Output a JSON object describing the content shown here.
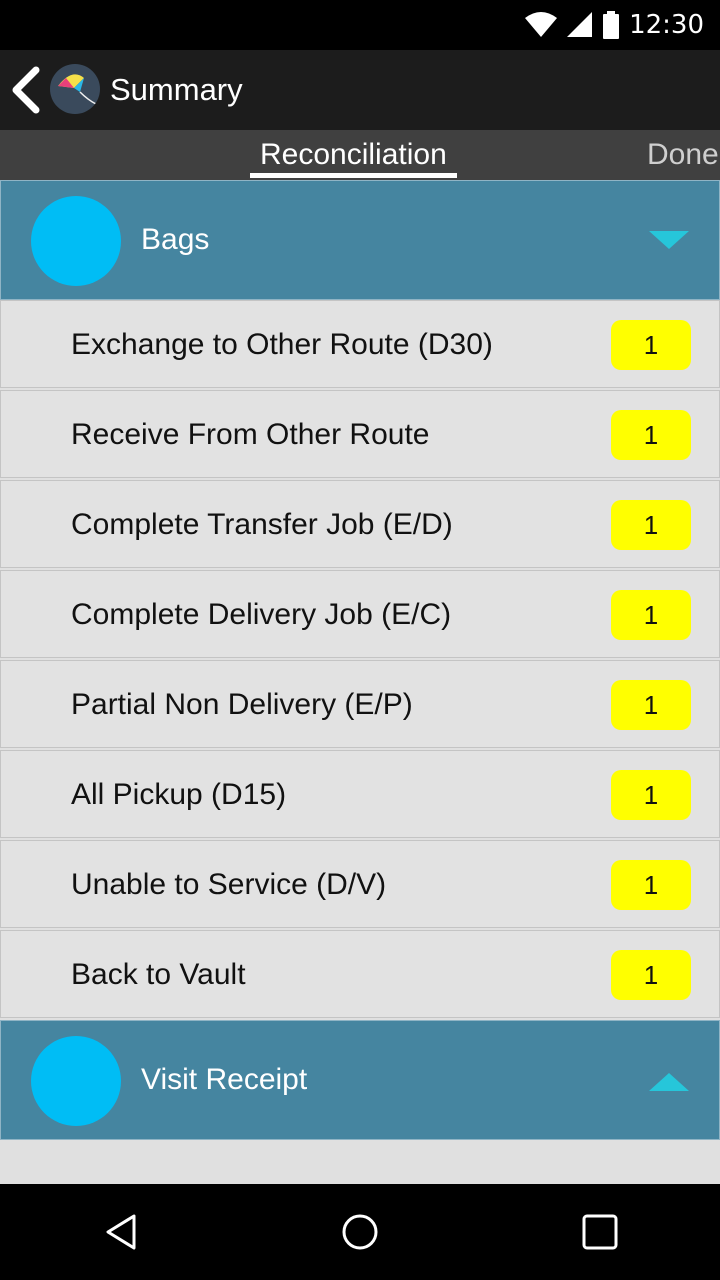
{
  "status_bar": {
    "time": "12:30",
    "icons": [
      "wifi-icon",
      "cell-signal-icon",
      "battery-icon"
    ]
  },
  "app_bar": {
    "title": "Summary",
    "back_icon": "chevron-left-icon",
    "logo_icon": "kite-logo-icon"
  },
  "tabs": [
    {
      "label": "Reconciliation",
      "active": true
    },
    {
      "label": "Done",
      "active": false
    }
  ],
  "sections": [
    {
      "label": "Bags",
      "expanded": true,
      "items": [
        {
          "label": "Exchange to Other Route (D30)",
          "count": "1"
        },
        {
          "label": "Receive From Other Route",
          "count": "1"
        },
        {
          "label": "Complete Transfer Job (E/D)",
          "count": "1"
        },
        {
          "label": "Complete Delivery Job (E/C)",
          "count": "1"
        },
        {
          "label": "Partial Non Delivery (E/P)",
          "count": "1"
        },
        {
          "label": "All Pickup (D15)",
          "count": "1"
        },
        {
          "label": "Unable to Service (D/V)",
          "count": "1"
        },
        {
          "label": "Back to Vault",
          "count": "1"
        }
      ]
    },
    {
      "label": "Visit Receipt",
      "expanded": false
    }
  ],
  "colors": {
    "section_header": "#4585a0",
    "section_circle": "#00bdf5",
    "badge": "#ffff00",
    "accent_arrow": "#26c6da"
  },
  "nav_bar": {
    "icons": [
      "back-triangle-icon",
      "home-circle-icon",
      "recents-square-icon"
    ]
  }
}
